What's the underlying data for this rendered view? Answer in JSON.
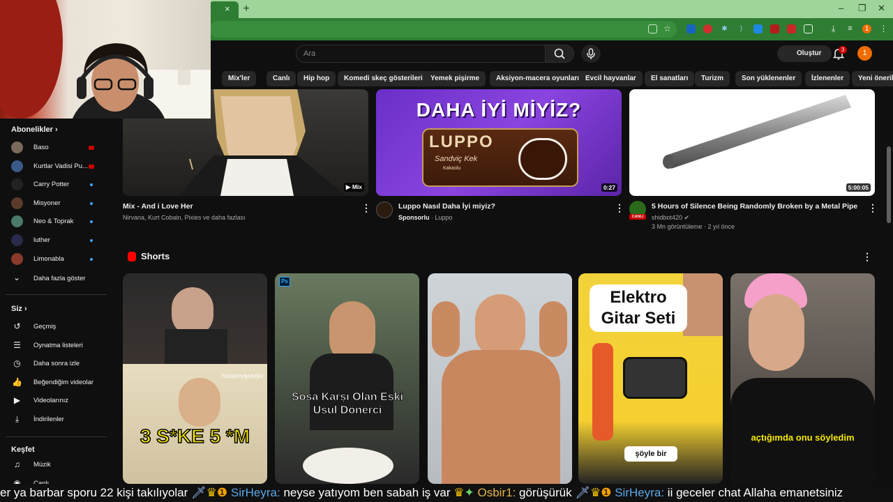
{
  "browser": {
    "tab_close": "×",
    "new_tab": "+",
    "minimize": "–",
    "restore": "❐",
    "close": "✕",
    "profile_initial": "1"
  },
  "header": {
    "search_placeholder": "Ara",
    "create_label": "Oluştur",
    "notification_count": "3",
    "avatar_initial": "1"
  },
  "chips": [
    "Mix'ler",
    "Canlı",
    "Hip hop",
    "Komedi skeç gösterileri",
    "Yemek pişirme",
    "Aksiyon-macera oyunları",
    "Evcil hayvanlar",
    "El sanatları",
    "Turizm",
    "Son yüklenenler",
    "İzlenenler",
    "Yeni öneriler"
  ],
  "sidebar": {
    "subscriptions_heading": "Abonelikler",
    "subscriptions": [
      {
        "label": "Baso",
        "status": "live",
        "color": "#7a6a5a"
      },
      {
        "label": "Kurtlar Vadisi Pu...",
        "status": "live",
        "color": "#3a5a8a"
      },
      {
        "label": "Carry Potter",
        "status": "new",
        "color": "#222222"
      },
      {
        "label": "Misyoner",
        "status": "new",
        "color": "#5a3a2a"
      },
      {
        "label": "Neo & Toprak",
        "status": "new",
        "color": "#4a7a6a"
      },
      {
        "label": "luther",
        "status": "new",
        "color": "#2a2a4a"
      },
      {
        "label": "Limonabla",
        "status": "new",
        "color": "#8a3a2a"
      }
    ],
    "show_more": "Daha fazla göster",
    "you_heading": "Siz",
    "you_items": [
      "Geçmiş",
      "Oynatma listeleri",
      "Daha sonra izle",
      "Beğendiğim videolar",
      "Videolarınız",
      "İndirilenler"
    ],
    "explore_heading": "Keşfet",
    "explore_items": [
      "Müzik",
      "Canlı"
    ]
  },
  "videos": [
    {
      "title": "Mix - And i Love Her",
      "meta": "Nirvana, Kurt Cobain, Pixies ve daha fazlası",
      "badge": "Mix"
    },
    {
      "title": "Luppo Nasıl Daha İyi miyiz?",
      "meta_bold": "Sponsorlu",
      "meta": " · Luppo",
      "badge": "0:27",
      "thumb_text": "DAHA İYİ MİYİZ?",
      "product": "LUPPO",
      "product_sub": "Sandviç Kek",
      "product_sub2": "Kakaolu"
    },
    {
      "title": "5 Hours of Silence Being Randomly Broken by a Metal Pipe",
      "channel": "shidbot420",
      "meta": "3 Mn görüntüleme · 2 yıl önce",
      "badge": "5:00:05",
      "live_label": "CANLI"
    }
  ],
  "shorts": {
    "heading": "Shorts",
    "items": [
      {
        "caption": "3 S*KE 5 *M",
        "overlay": "husamviyuviyu"
      },
      {
        "caption": "Sosa Karşı Olan Eski Usul Dönerci",
        "ps": "Ps"
      },
      {
        "caption": ""
      },
      {
        "caption": "Elektro Gitar Seti",
        "sub": "şöyle bir"
      },
      {
        "caption": "açtığımda onu söyledim"
      }
    ]
  },
  "ticker": {
    "text1": "er ya barbar sporu 22 kişi takılıyolar",
    "name1": "SirHeyra:",
    "msg1": "neyse yatıyom ben sabah iş var",
    "name2": "Osbir1:",
    "msg2": "görüşürük",
    "name3": "SirHeyra:",
    "msg3": "ii geceler chat Allaha emanetsiniz"
  }
}
